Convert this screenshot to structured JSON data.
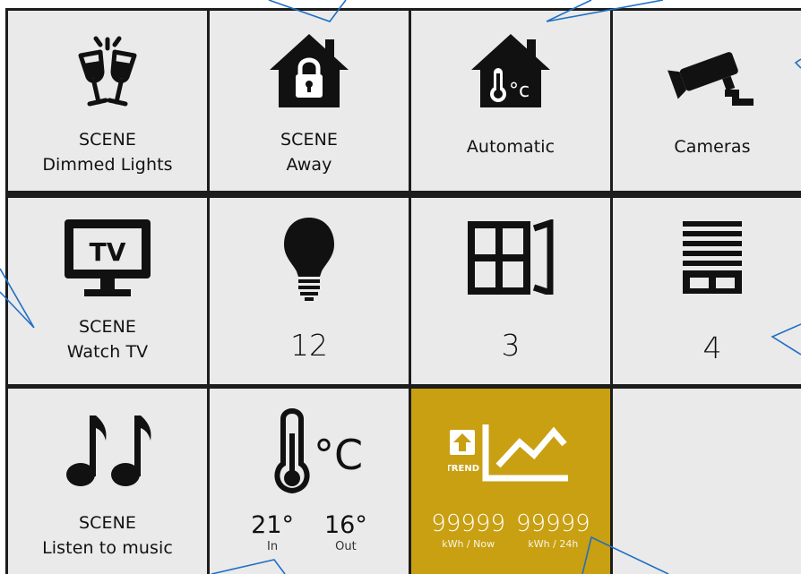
{
  "tiles": {
    "dimmed": {
      "line1": "SCENE",
      "line2": "Dimmed Lights",
      "icon": "wine-glasses-icon"
    },
    "away": {
      "line1": "SCENE",
      "line2": "Away",
      "icon": "house-lock-icon"
    },
    "automatic": {
      "label": "Automatic",
      "icon": "house-thermometer-icon",
      "icon_text": "°c"
    },
    "cameras": {
      "label": "Cameras",
      "icon": "security-camera-icon"
    },
    "watchtv": {
      "line1": "SCENE",
      "line2": "Watch TV",
      "icon": "tv-icon",
      "icon_text": "TV"
    },
    "lights": {
      "value": "12",
      "icon": "light-bulb-icon"
    },
    "windows": {
      "value": "3",
      "icon": "window-icon"
    },
    "blinds": {
      "value": "4",
      "icon": "blinds-icon"
    },
    "music": {
      "line1": "SCENE",
      "line2": "Listen to music",
      "icon": "music-notes-icon"
    },
    "temperature": {
      "icon": "thermometer-celsius-icon",
      "icon_text": "°C",
      "in_value": "21°",
      "in_label": "In",
      "out_value": "16°",
      "out_label": "Out"
    },
    "trend": {
      "icon": "trend-chart-icon",
      "badge_text": "TREND",
      "now_value": "99999",
      "now_label": "kWh / Now",
      "day_value": "99999",
      "day_label": "kWh / 24h",
      "color": "#c8a012"
    }
  },
  "colors": {
    "tile": "#eaeaea",
    "grid": "#1d1d1d",
    "accent": "#c8a012",
    "callout": "#1f6fc4"
  }
}
